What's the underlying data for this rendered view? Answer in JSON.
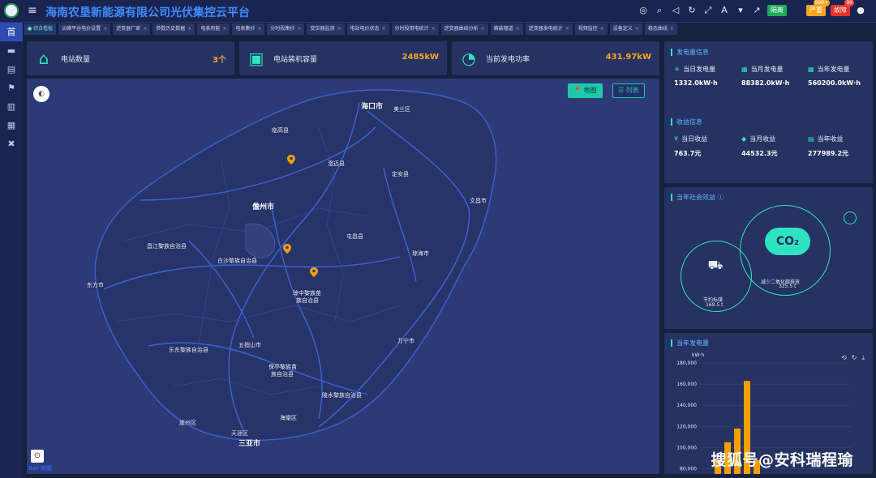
{
  "app": {
    "title": "海南农垦新能源有限公司光伏集控云平台"
  },
  "topbar": {
    "icons": [
      "globe-icon",
      "search-icon",
      "speaker-icon",
      "refresh-icon",
      "fullscreen-icon",
      "translate-icon",
      "shirt-icon",
      "trend-icon"
    ],
    "badges": [
      {
        "label": "隔离",
        "color": "#1aae5a",
        "count": ""
      },
      {
        "label": "严重",
        "color": "#f5a623",
        "count": "999+"
      },
      {
        "label": "故障",
        "color": "#e5302a",
        "count": "99"
      }
    ],
    "user_icon": "user-icon"
  },
  "rail": {
    "items": [
      "首",
      "▬",
      "▤",
      "⚑",
      "▥",
      "▦",
      "✖"
    ]
  },
  "tabs": [
    {
      "label": "综合看板",
      "active": true
    },
    {
      "label": "尖峰平谷电价设置",
      "active": false
    },
    {
      "label": "逆变器厂家",
      "active": false
    },
    {
      "label": "参数历史数据",
      "active": false
    },
    {
      "label": "电表用能",
      "active": false
    },
    {
      "label": "电表集抄",
      "active": false
    },
    {
      "label": "分时段集抄",
      "active": false
    },
    {
      "label": "变压器监测",
      "active": false
    },
    {
      "label": "电站电价状态",
      "active": false
    },
    {
      "label": "分时段用电统计",
      "active": false
    },
    {
      "label": "逆变器曲线分析",
      "active": false
    },
    {
      "label": "箱装辐道",
      "active": false
    },
    {
      "label": "逆变器发电统计",
      "active": false
    },
    {
      "label": "视频监控",
      "active": false
    },
    {
      "label": "设备定义",
      "active": false
    },
    {
      "label": "稳态曲线",
      "active": false
    }
  ],
  "stats": [
    {
      "label": "电站数量",
      "value": "3个",
      "icon": "house-bolt-icon"
    },
    {
      "label": "电站装机容量",
      "value": "2485kW",
      "icon": "battery-bolt-icon"
    },
    {
      "label": "当前发电功率",
      "value": "431.97kW",
      "icon": "gauge-icon"
    }
  ],
  "map": {
    "btn_map": "地图",
    "btn_list": "列表",
    "baidu": "Bai",
    "baidu2": "地图",
    "places": [
      {
        "name": "海口市",
        "big": true
      },
      {
        "name": "美兰区",
        "big": false
      },
      {
        "name": "临高县",
        "big": false
      },
      {
        "name": "澄迈县",
        "big": false
      },
      {
        "name": "定安县",
        "big": false
      },
      {
        "name": "儋州市",
        "big": true
      },
      {
        "name": "文昌市",
        "big": false
      },
      {
        "name": "屯昌县",
        "big": false
      },
      {
        "name": "昌江黎族自治县",
        "big": false
      },
      {
        "name": "白沙黎族自治县",
        "big": false
      },
      {
        "name": "琼海市",
        "big": false
      },
      {
        "name": "东方市",
        "big": false
      },
      {
        "name": "琼中黎族苗",
        "big": false
      },
      {
        "name": "族自治县",
        "big": false
      },
      {
        "name": "万宁市",
        "big": false
      },
      {
        "name": "五指山市",
        "big": false
      },
      {
        "name": "乐东黎族自治县",
        "big": false
      },
      {
        "name": "保亭黎族苗",
        "big": false
      },
      {
        "name": "族自治县",
        "big": false
      },
      {
        "name": "陵水黎族自治县",
        "big": false
      },
      {
        "name": "海棠区",
        "big": false
      },
      {
        "name": "崖州区",
        "big": false
      },
      {
        "name": "天涯区",
        "big": false
      },
      {
        "name": "三亚市",
        "big": true
      }
    ]
  },
  "power_info": {
    "title": "发电量信息",
    "items": [
      {
        "label": "当日发电量",
        "value": "1332.0kW·h",
        "icon": "sun-icon"
      },
      {
        "label": "当月发电量",
        "value": "88382.0kW·h",
        "icon": "calendar-icon"
      },
      {
        "label": "当年发电量",
        "value": "560200.0kW·h",
        "icon": "calendar-icon"
      }
    ]
  },
  "revenue_info": {
    "title": "收益信息",
    "items": [
      {
        "label": "当日收益",
        "value": "763.7元",
        "icon": "money-icon"
      },
      {
        "label": "当月收益",
        "value": "44532.3元",
        "icon": "moneybag-icon"
      },
      {
        "label": "当年收益",
        "value": "277989.2元",
        "icon": "coins-icon"
      }
    ]
  },
  "social": {
    "title": "当年社会效益",
    "coal_label": "节约标煤",
    "coal_value": "169.5 t",
    "co2_label": "减少二氧化碳排放",
    "co2_value": "325.5 t",
    "co2_text": "CO₂"
  },
  "annual_chart_panel": {
    "title": "当年发电量",
    "unit": "kW·h"
  },
  "chart_data": {
    "type": "bar",
    "title": "",
    "xlabel": "",
    "ylabel": "kW·h",
    "ylim": [
      75000,
      180000
    ],
    "yticks": [
      "180,000",
      "160,000",
      "140,000",
      "120,000",
      "100,000",
      "80,000"
    ],
    "categories": [
      "",
      "",
      "",
      "",
      "",
      ""
    ],
    "values": [
      88000,
      105000,
      118000,
      163000,
      88000,
      72000
    ],
    "color": "#f5a000"
  },
  "watermark": "搜狐号@安科瑞程瑜"
}
